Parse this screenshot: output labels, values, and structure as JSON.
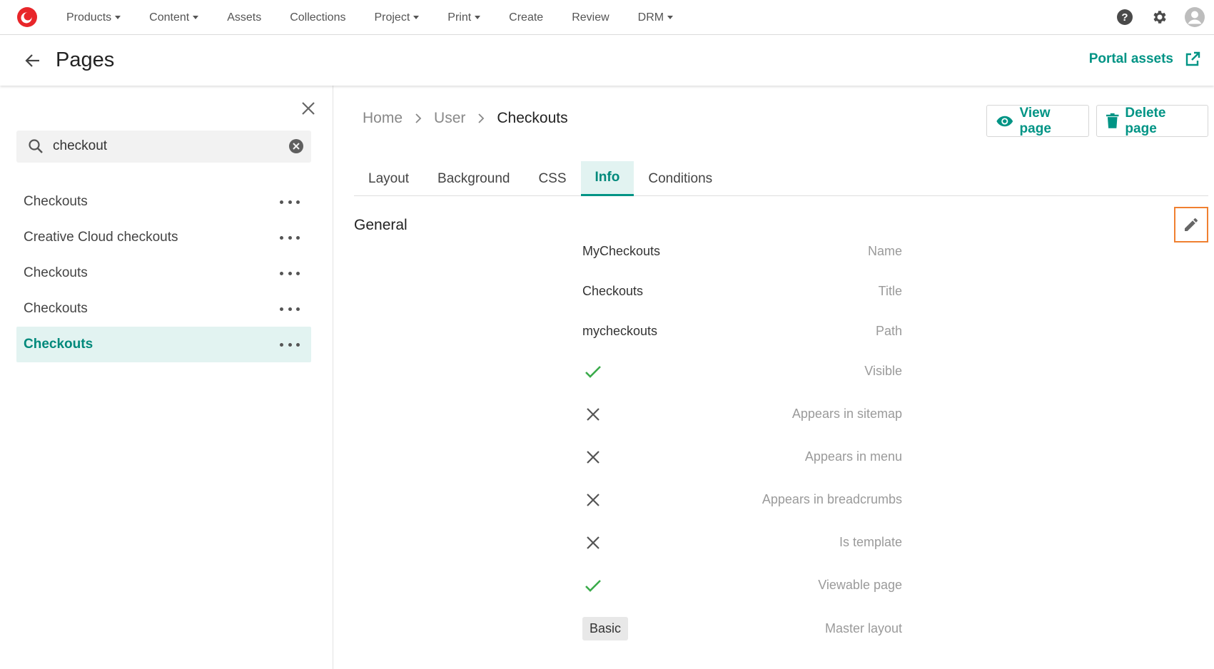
{
  "topnav": {
    "items": [
      {
        "label": "Products",
        "dropdown": true
      },
      {
        "label": "Content",
        "dropdown": true
      },
      {
        "label": "Assets",
        "dropdown": false
      },
      {
        "label": "Collections",
        "dropdown": false
      },
      {
        "label": "Project",
        "dropdown": true
      },
      {
        "label": "Print",
        "dropdown": true
      },
      {
        "label": "Create",
        "dropdown": false
      },
      {
        "label": "Review",
        "dropdown": false
      },
      {
        "label": "DRM",
        "dropdown": true
      }
    ],
    "icons": [
      "help-icon",
      "gear-icon",
      "avatar-icon"
    ]
  },
  "header": {
    "title": "Pages",
    "portal_label": "Portal assets"
  },
  "sidebar": {
    "search": {
      "value": "checkout"
    },
    "items": [
      {
        "label": "Checkouts",
        "active": false
      },
      {
        "label": "Creative Cloud checkouts",
        "active": false
      },
      {
        "label": "Checkouts",
        "active": false
      },
      {
        "label": "Checkouts",
        "active": false
      },
      {
        "label": "Checkouts",
        "active": true
      }
    ]
  },
  "main": {
    "breadcrumb": [
      "Home",
      "User",
      "Checkouts"
    ],
    "view_label": "View page",
    "delete_label": "Delete page",
    "tabs": [
      {
        "label": "Layout",
        "active": false
      },
      {
        "label": "Background",
        "active": false
      },
      {
        "label": "CSS",
        "active": false
      },
      {
        "label": "Info",
        "active": true
      },
      {
        "label": "Conditions",
        "active": false
      }
    ],
    "section_title": "General",
    "fields": {
      "name": {
        "label": "Name",
        "value": "MyCheckouts"
      },
      "title": {
        "label": "Title",
        "value": "Checkouts"
      },
      "path": {
        "label": "Path",
        "value": "mycheckouts"
      },
      "visible": {
        "label": "Visible",
        "value": true
      },
      "sitemap": {
        "label": "Appears in sitemap",
        "value": false
      },
      "menu": {
        "label": "Appears in menu",
        "value": false
      },
      "breadcrumbs": {
        "label": "Appears in breadcrumbs",
        "value": false
      },
      "template": {
        "label": "Is template",
        "value": false
      },
      "viewable": {
        "label": "Viewable page",
        "value": true
      },
      "master_layout": {
        "label": "Master layout",
        "value": "Basic"
      }
    }
  },
  "colors": {
    "accent": "#009485",
    "active_bg": "#e2f3f1",
    "check": "#3aab4a",
    "highlight_border": "#f08030"
  }
}
